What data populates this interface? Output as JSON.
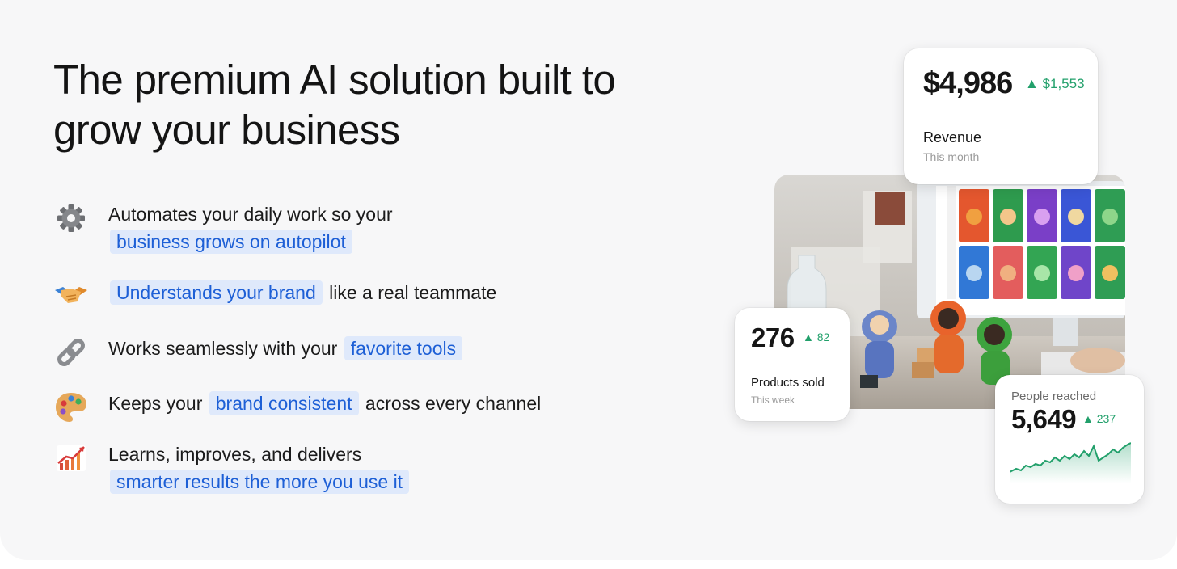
{
  "headline": {
    "line1": "The premium AI solution built to",
    "line2": "grow your business"
  },
  "features": [
    {
      "icon": "gear-icon",
      "pre": "Automates your daily work so your",
      "highlight": "business grows on autopilot",
      "post": ""
    },
    {
      "icon": "handshake-icon",
      "pre": "",
      "highlight": "Understands your brand",
      "post": "like a real teammate"
    },
    {
      "icon": "link-icon",
      "pre": "Works seamlessly with your",
      "highlight": "favorite tools",
      "post": ""
    },
    {
      "icon": "palette-icon",
      "pre": "Keeps your",
      "highlight": "brand consistent",
      "post": "across every channel"
    },
    {
      "icon": "chart-increasing-icon",
      "pre": "Learns, improves, and delivers",
      "highlight": "smarter results the more you use it",
      "post": ""
    }
  ],
  "cards": {
    "revenue": {
      "value": "$4,986",
      "delta": "▲ $1,553",
      "label": "Revenue",
      "period": "This month"
    },
    "products": {
      "value": "276",
      "delta": "▲ 82",
      "label": "Products sold",
      "period": "This week"
    },
    "people": {
      "label": "People reached",
      "value": "5,649",
      "delta": "▲ 237"
    }
  },
  "colors": {
    "highlight_bg": "#dfe9fb",
    "highlight_text": "#1d5fd6",
    "positive": "#22a06b",
    "panel_bg": "#f7f7f8"
  }
}
